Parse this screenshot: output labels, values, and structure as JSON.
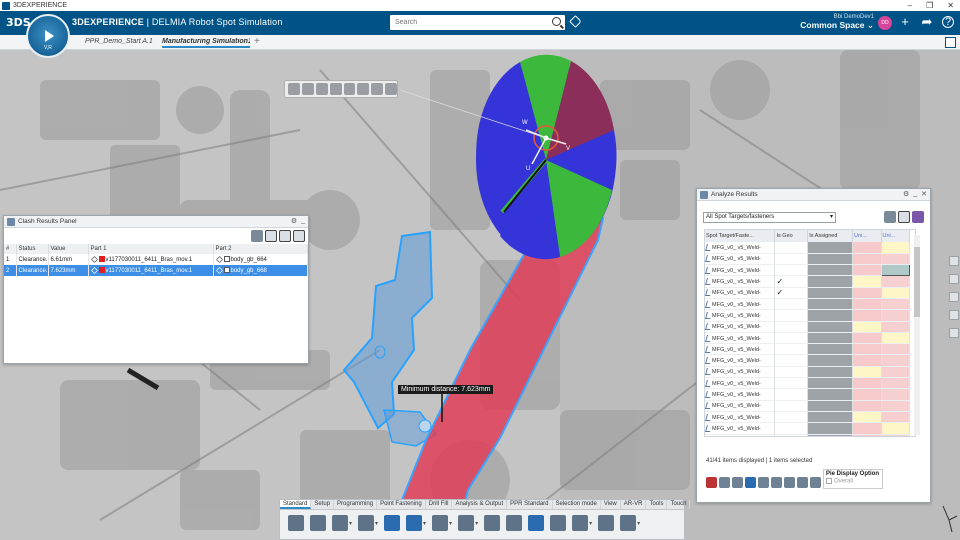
{
  "window": {
    "title": "3DEXPERIENCE",
    "controls": [
      "–",
      "❐",
      "✕"
    ]
  },
  "header": {
    "brand_logo": "3DS",
    "brand_bold": "3DEXPERIENCE",
    "brand_rest": " | DELMIA Robot Spot Simulation",
    "compass_label": "V,R",
    "search_placeholder": "Search",
    "user_name": "Bbi  DemoDev1",
    "space": "Common Space ⌄",
    "avatar": "DD",
    "accent": "#005386"
  },
  "tabs": [
    {
      "label": "PPR_Demo_Start A.1",
      "active": false
    },
    {
      "label": "Manufacturing Simulation1",
      "active": true
    }
  ],
  "viewport": {
    "distance_label": "Minimum distance: 7.623mm",
    "pie_labels": [
      "W",
      "V",
      "U"
    ]
  },
  "clash_panel": {
    "title": "Clash Results Panel",
    "columns": [
      "#",
      "Status",
      "Value",
      "Part 1",
      "Part 2"
    ],
    "rows": [
      {
        "num": "1",
        "status": "Clearance...",
        "value": "6.61mm",
        "part1": "v1177030011_6411_Bras_mov.1",
        "part2": "body_gb_664",
        "selected": false
      },
      {
        "num": "2",
        "status": "Clearance...",
        "value": "7.623mm",
        "part1": "v1177030011_6411_Bras_mov.1",
        "part2": "body_gb_668",
        "selected": true
      }
    ]
  },
  "analyze_panel": {
    "title": "Analyze Results",
    "filter": "All Spot Targets/fasteners",
    "columns": [
      "Spot Target/Faste...",
      "Is Geo",
      "Is Assigned",
      "Uni...",
      "Uni..."
    ],
    "row_label": "MFG_v0_ v5_Weld-",
    "rows": [
      {
        "name": "MFG_v0_ v5_Weld-",
        "geo": "",
        "u2": "y"
      },
      {
        "name": "MFG_v0_ v5_Weld-",
        "geo": "",
        "u2": ""
      },
      {
        "name": "MFG_v0_ v5_Weld-",
        "geo": "",
        "u2": "g"
      },
      {
        "name": "MFG_v0_ v5_Weld-",
        "geo": "✓",
        "u2": "",
        "u1y": true
      },
      {
        "name": "MFG_v0_ v5_Weld-",
        "geo": "✓",
        "u2": "y"
      },
      {
        "name": "MFG_v0_ v5_Weld-",
        "geo": "",
        "u2": ""
      },
      {
        "name": "MFG_v0_ v5_Weld-",
        "geo": "",
        "u2": ""
      },
      {
        "name": "MFG_v0_ v5_Weld-",
        "geo": "",
        "u2": "",
        "u1y": true
      },
      {
        "name": "MFG_v0_ v5_Weld-",
        "geo": "",
        "u2": "y"
      },
      {
        "name": "MFG_v0_ v5_Weld-",
        "geo": "",
        "u2": ""
      },
      {
        "name": "MFG_v0_ v5_Weld-",
        "geo": "",
        "u2": ""
      },
      {
        "name": "MFG_v0_ v5_Weld-",
        "geo": "",
        "u2": "",
        "u1y": true
      },
      {
        "name": "MFG_v0_ v5_Weld-",
        "geo": "",
        "u2": ""
      },
      {
        "name": "MFG_v0_ v5_Weld-",
        "geo": "",
        "u2": ""
      },
      {
        "name": "MFG_v0_ v5_Weld-",
        "geo": "",
        "u2": ""
      },
      {
        "name": "MFG_v0_ v5_Weld-",
        "geo": "",
        "u2": "",
        "u1y": true
      },
      {
        "name": "MFG_v0_ v5_Weld-",
        "geo": "",
        "u2": "y"
      },
      {
        "name": "MFG_v0_ v5_Weld-",
        "geo": "",
        "u2": ""
      }
    ],
    "status": "41/41 items displayed | 1 items selected",
    "pie_option_title": "Pie Display Option",
    "pie_option_value": "Overall"
  },
  "action_bar": {
    "tabs": [
      "Standard",
      "Setup",
      "Programming",
      "Point Fastening",
      "Drill Fill",
      "Analysis & Output",
      "PPR Standard",
      "Selection mode",
      "View",
      "AR-VR",
      "Tools",
      "Touch"
    ],
    "active_tab": "Standard"
  }
}
